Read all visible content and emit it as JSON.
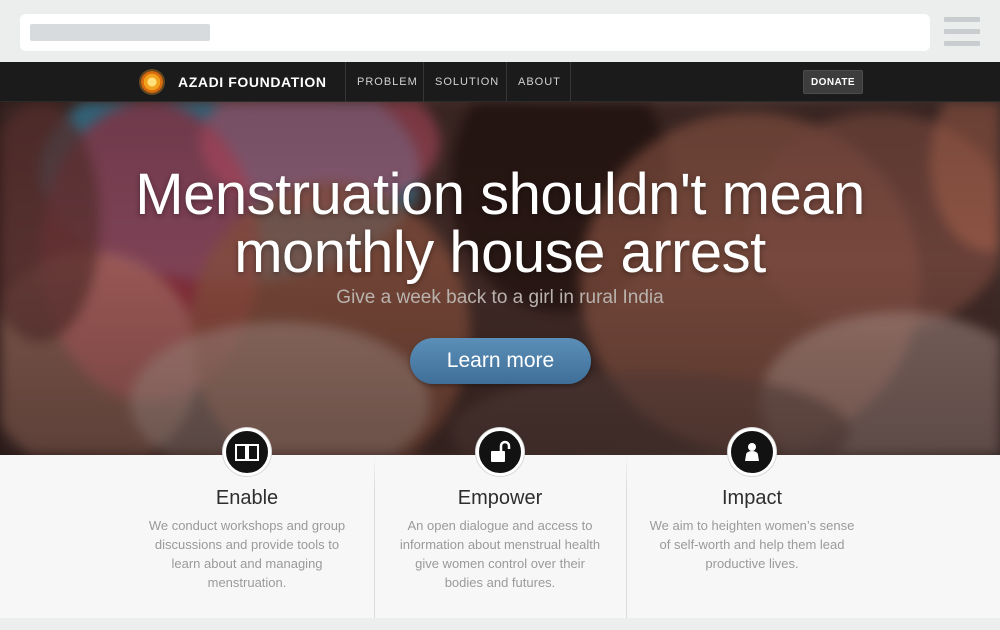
{
  "browser": {
    "address_placeholder": ""
  },
  "nav": {
    "brand": "AZADI FOUNDATION",
    "links": [
      {
        "label": "PROBLEM"
      },
      {
        "label": "SOLUTION"
      },
      {
        "label": "ABOUT"
      }
    ],
    "donate_label": "DONATE"
  },
  "hero": {
    "headline_line1": "Menstruation shouldn't mean",
    "headline_line2": "monthly house arrest",
    "subheadline": "Give a week back to a girl in rural India",
    "cta_label": "Learn more"
  },
  "features": [
    {
      "icon": "book-icon",
      "title": "Enable",
      "lines": [
        "We conduct workshops and group",
        "discussions and provide tools to",
        "learn about and managing",
        "menstruation."
      ]
    },
    {
      "icon": "unlock-icon",
      "title": "Empower",
      "lines": [
        "An open dialogue and access to",
        "information about menstrual health",
        "give women control over their",
        "bodies and futures."
      ]
    },
    {
      "icon": "person-icon",
      "title": "Impact",
      "lines": [
        "We aim to heighten women’s sense",
        "of self-worth and help them lead",
        "productive lives."
      ]
    }
  ],
  "colors": {
    "nav_bg": "#1b1b1b",
    "cta_blue": "#4a7ba6",
    "feature_bg": "#f7f7f7",
    "logo_orange": "#f1a21c"
  }
}
